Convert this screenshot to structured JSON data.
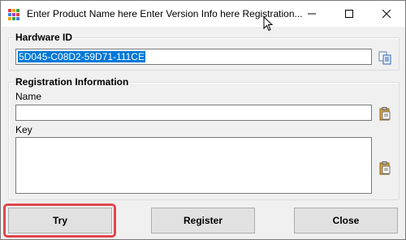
{
  "window": {
    "title": "Enter Product Name here Enter Version Info here Registration...",
    "icon": "app-grid-icon"
  },
  "hardware": {
    "group_label": "Hardware ID",
    "id_value": "5D045-C08D2-59D71-111CE",
    "copy_icon": "copy-icon"
  },
  "registration": {
    "group_label": "Registration Information",
    "name_label": "Name",
    "name_value": "",
    "key_label": "Key",
    "key_value": "",
    "paste_icon": "clipboard-paste-icon"
  },
  "buttons": {
    "try": "Try",
    "register": "Register",
    "close": "Close"
  },
  "colors": {
    "selection": "#0078d7",
    "highlight": "#e0484d"
  }
}
